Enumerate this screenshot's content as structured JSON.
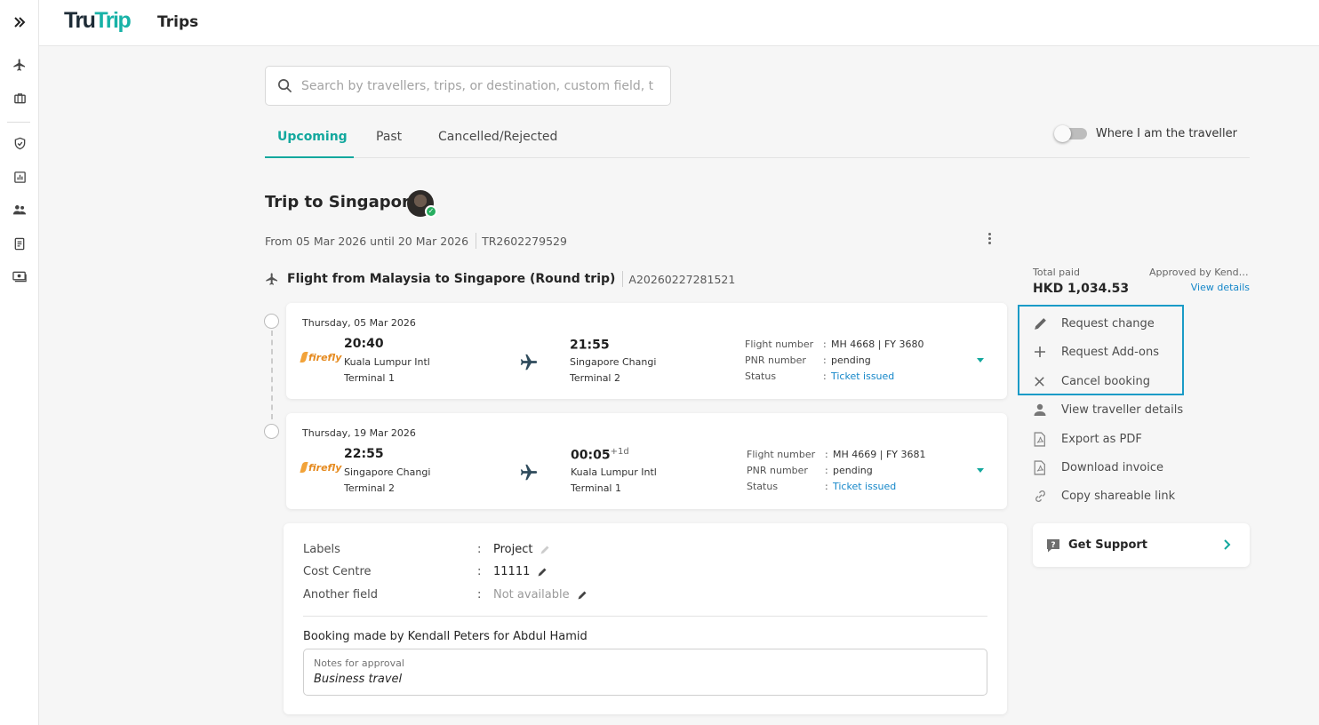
{
  "app": {
    "logo_part1": "Tru",
    "logo_part2": "Trip",
    "page_title": "Trips"
  },
  "rail": {
    "icons": [
      "expand-icon",
      "plane-icon",
      "suitcase-icon",
      "shield-icon",
      "report-icon",
      "people-icon",
      "document-icon",
      "money-icon"
    ]
  },
  "search": {
    "placeholder": "Search by travellers, trips, or destination, custom field, t"
  },
  "tabs": [
    {
      "label": "Upcoming",
      "active": true
    },
    {
      "label": "Past",
      "active": false
    },
    {
      "label": "Cancelled/Rejected",
      "active": false
    }
  ],
  "toggle": {
    "label": "Where I am the traveller",
    "on": false
  },
  "trip": {
    "title": "Trip to Singapore",
    "dates": "From 05 Mar 2026 until 20 Mar 2026",
    "trip_id": "TR2602279529"
  },
  "flight": {
    "title": "Flight from Malaysia to Singapore (Round trip)",
    "booking_id": "A20260227281521",
    "segments": [
      {
        "date": "Thursday, 05 Mar 2026",
        "airline": "firefly",
        "dep_time": "20:40",
        "dep_airport": "Kuala Lumpur Intl",
        "dep_terminal": "Terminal 1",
        "arr_time": "21:55",
        "arr_day_offset": "",
        "arr_airport": "Singapore Changi",
        "arr_terminal": "Terminal 2",
        "flight_number_label": "Flight number",
        "flight_number": "MH 4668 | FY 3680",
        "pnr_label": "PNR number",
        "pnr": "pending",
        "status_label": "Status",
        "status": "Ticket issued"
      },
      {
        "date": "Thursday, 19 Mar 2026",
        "airline": "firefly",
        "dep_time": "22:55",
        "dep_airport": "Singapore Changi",
        "dep_terminal": "Terminal 2",
        "arr_time": "00:05",
        "arr_day_offset": "+1d",
        "arr_airport": "Kuala Lumpur Intl",
        "arr_terminal": "Terminal 1",
        "flight_number_label": "Flight number",
        "flight_number": "MH 4669 | FY 3681",
        "pnr_label": "PNR number",
        "pnr": "pending",
        "status_label": "Status",
        "status": "Ticket issued"
      }
    ]
  },
  "details": {
    "fields": [
      {
        "label": "Labels",
        "value": "Project",
        "muted": false
      },
      {
        "label": "Cost Centre",
        "value": "11111",
        "muted": false
      },
      {
        "label": "Another field",
        "value": "Not available",
        "muted": true
      }
    ],
    "colon": ":",
    "booked_by": "Booking made by Kendall Peters for Abdul Hamid",
    "notes_label": "Notes for approval",
    "notes_value": "Business travel"
  },
  "payment": {
    "total_label": "Total paid",
    "total_value": "HKD 1,034.53",
    "approved_by": "Approved by Kenda...",
    "view_details": "View details"
  },
  "actions": [
    {
      "label": "Request change",
      "icon": "pencil-icon"
    },
    {
      "label": "Request Add-ons",
      "icon": "plus-icon"
    },
    {
      "label": "Cancel booking",
      "icon": "close-icon"
    },
    {
      "label": "View traveller details",
      "icon": "person-icon"
    },
    {
      "label": "Export as PDF",
      "icon": "pdf-icon"
    },
    {
      "label": "Download invoice",
      "icon": "pdf-icon"
    },
    {
      "label": "Copy shareable link",
      "icon": "link-icon"
    }
  ],
  "support": {
    "label": "Get Support"
  },
  "colors": {
    "brand": "#13a89e",
    "link": "#1587c9",
    "highlight": "#1a9bc7",
    "airline": "#e58a1f"
  }
}
